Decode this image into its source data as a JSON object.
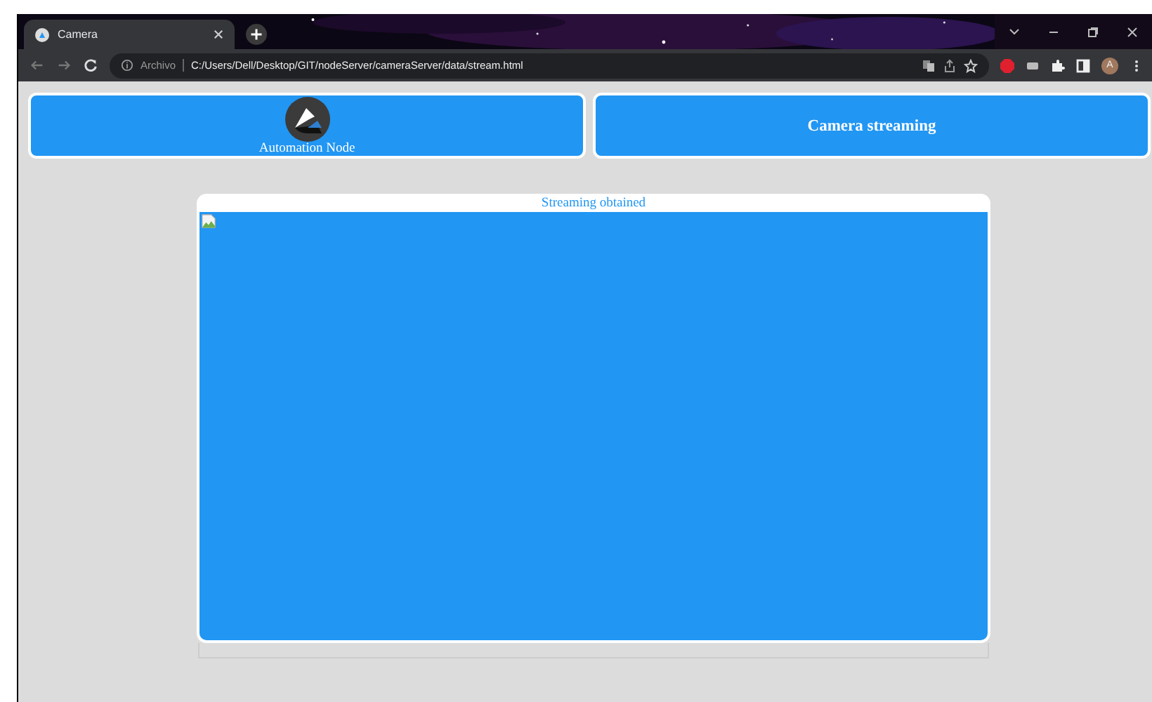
{
  "browser": {
    "tab": {
      "title": "Camera",
      "selected": true
    },
    "address": {
      "security_label": "Archivo",
      "url": "C:/Users/Dell/Desktop/GIT/nodeServer/cameraServer/data/stream.html"
    },
    "profile": "A"
  },
  "header": {
    "brand": "Automation Node",
    "title": "Camera streaming"
  },
  "stream": {
    "caption": "Streaming obtained",
    "image_loaded": false
  }
}
